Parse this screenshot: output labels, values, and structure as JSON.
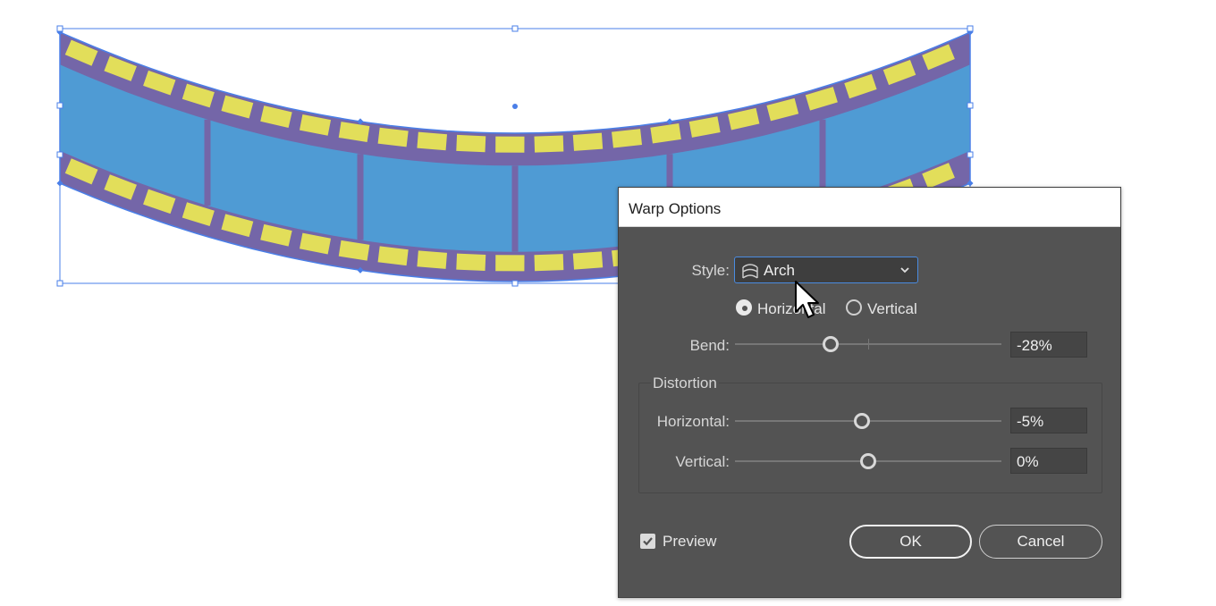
{
  "dialog": {
    "title": "Warp Options",
    "style": {
      "label": "Style:",
      "value": "Arch",
      "icon": "arch-icon"
    },
    "orientation": {
      "options": [
        {
          "label": "Horizontal",
          "checked": true
        },
        {
          "label": "Vertical",
          "checked": false
        }
      ]
    },
    "bend": {
      "label": "Bend:",
      "value": "-28%",
      "level": -28
    },
    "distortion": {
      "group_label": "Distortion",
      "horizontal": {
        "label": "Horizontal:",
        "value": "-5%",
        "level": -5
      },
      "vertical": {
        "label": "Vertical:",
        "value": "0%",
        "level": 0
      }
    },
    "preview": {
      "label": "Preview",
      "checked": true
    },
    "ok_label": "OK",
    "cancel_label": "Cancel"
  },
  "colors": {
    "film_fill": "#4f9bd4",
    "film_frame": "#7466a8",
    "film_sprocket": "#e2de5a",
    "selection": "#4a7fe8",
    "dialog_bg": "#535353"
  }
}
